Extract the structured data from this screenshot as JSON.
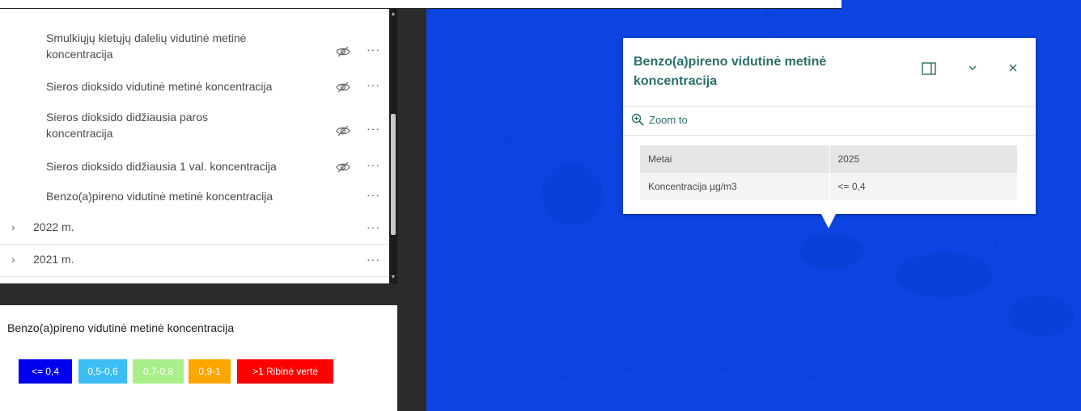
{
  "layer_list": {
    "items": [
      {
        "label_lines": [
          "Smulkiųjų kietųjų dalelių vidutinė metinė",
          "koncentracija"
        ],
        "hidden_icon": "eye-off-icon",
        "menu_icon": "more-icon"
      },
      {
        "label_lines": [
          "Sieros dioksido vidutinė metinė koncentracija"
        ],
        "hidden_icon": "eye-off-icon",
        "menu_icon": "more-icon"
      },
      {
        "label_lines": [
          "Sieros dioksido didžiausia paros",
          "koncentracija"
        ],
        "hidden_icon": "eye-off-icon",
        "menu_icon": "more-icon"
      },
      {
        "label_lines": [
          "Sieros dioksido didžiausia 1 val. koncentracija"
        ],
        "hidden_icon": "eye-off-icon",
        "menu_icon": "more-icon"
      },
      {
        "label_lines": [
          "Benzo(a)pireno vidutinė metinė koncentracija"
        ],
        "menu_icon": "more-icon"
      }
    ],
    "groups": [
      {
        "label": "2022 m.",
        "chevron": "›",
        "menu": "···"
      },
      {
        "label": "2021 m.",
        "chevron": "›",
        "menu": "···"
      }
    ],
    "menu_glyph": "···"
  },
  "legend": {
    "title": "Benzo(a)pireno vidutinė metinė koncentracija",
    "classes": [
      {
        "label": "<= 0,4",
        "color": "#0000ee",
        "text_color": "#ffffff"
      },
      {
        "label": "0,5-0,6",
        "color": "#3cbef5",
        "text_color": "#ffffff"
      },
      {
        "label": "0,7-0,8",
        "color": "#a8ef8a",
        "text_color": "#ffffff"
      },
      {
        "label": "0,9-1",
        "color": "#ffa500",
        "text_color": "#ffffff"
      },
      {
        "label": ">1 Ribinė vertė",
        "color": "#ff0000",
        "text_color": "#ffffff"
      }
    ]
  },
  "popup": {
    "title_line1": "Benzo(a)pireno vidutinė metinė",
    "title_line2": "koncentracija",
    "zoom_label": "Zoom to",
    "attributes": [
      {
        "key": "Metai",
        "value": "2025"
      },
      {
        "key": "Koncentracija µg/m3",
        "value": "<= 0,4"
      }
    ],
    "actions": {
      "dock_icon": "dock-icon",
      "collapse_icon": "chevron-down-icon",
      "close_icon": "close-icon"
    }
  },
  "map": {
    "background_color": "#0b44e0"
  }
}
